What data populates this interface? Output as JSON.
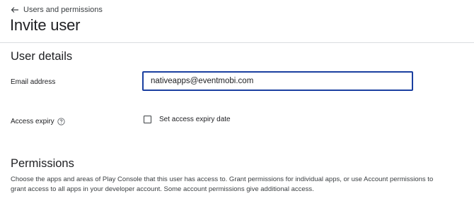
{
  "breadcrumb": {
    "icon": "arrow-back-icon",
    "label": "Users and permissions"
  },
  "page": {
    "title": "Invite user"
  },
  "user_details": {
    "title": "User details",
    "email": {
      "label": "Email address",
      "value": "nativeapps@eventmobi.com"
    },
    "expiry": {
      "label": "Access expiry",
      "help_icon": "help-circle-icon",
      "checkbox_label": "Set access expiry date",
      "checked": false
    }
  },
  "permissions": {
    "title": "Permissions",
    "description": "Choose the apps and areas of Play Console that this user has access to. Grant permissions for individual apps, or use Account permissions to grant access to all apps in your developer account. Some account permissions give additional access."
  },
  "colors": {
    "focus_border": "#1a3fa0",
    "text_primary": "#202124",
    "divider": "#dadce0"
  }
}
